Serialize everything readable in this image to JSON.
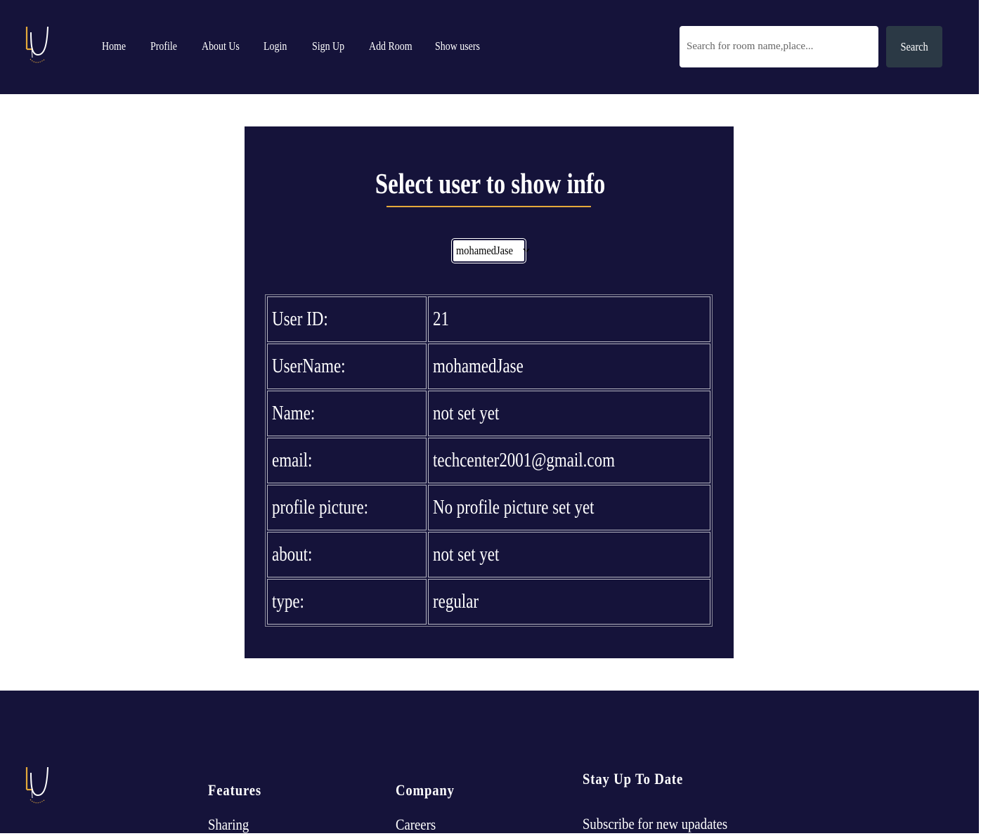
{
  "nav": {
    "links": [
      "Home",
      "Profile",
      "About Us",
      "Login",
      "Sign Up",
      "Add Room",
      "Show users"
    ],
    "search_placeholder": "Search for room name,place...",
    "search_button": "Search"
  },
  "main": {
    "title": "Select user to show info",
    "selected_user": "mohamedJase",
    "table": {
      "rows": [
        {
          "label": "User ID:",
          "value": "21"
        },
        {
          "label": "UserName:",
          "value": "mohamedJase"
        },
        {
          "label": "Name:",
          "value": "not set yet"
        },
        {
          "label": "email:",
          "value": "techcenter2001@gmail.com"
        },
        {
          "label": "profile picture:",
          "value": "No profile picture set yet"
        },
        {
          "label": "about:",
          "value": "not set yet"
        },
        {
          "label": "type:",
          "value": "regular"
        }
      ]
    }
  },
  "footer": {
    "features": {
      "heading": "Features",
      "links": [
        "Sharing"
      ]
    },
    "company": {
      "heading": "Company",
      "links": [
        "Careers"
      ]
    },
    "newsletter": {
      "heading": "Stay Up To Date",
      "text": "Subscribe for new upadates"
    }
  },
  "colors": {
    "navy": "#15133a",
    "accent_gold": "#e5a93a",
    "search_button": "#2b3945"
  },
  "icons": {
    "logo": "lu-logo-icon",
    "select_chevron": "chevron-down-icon"
  }
}
